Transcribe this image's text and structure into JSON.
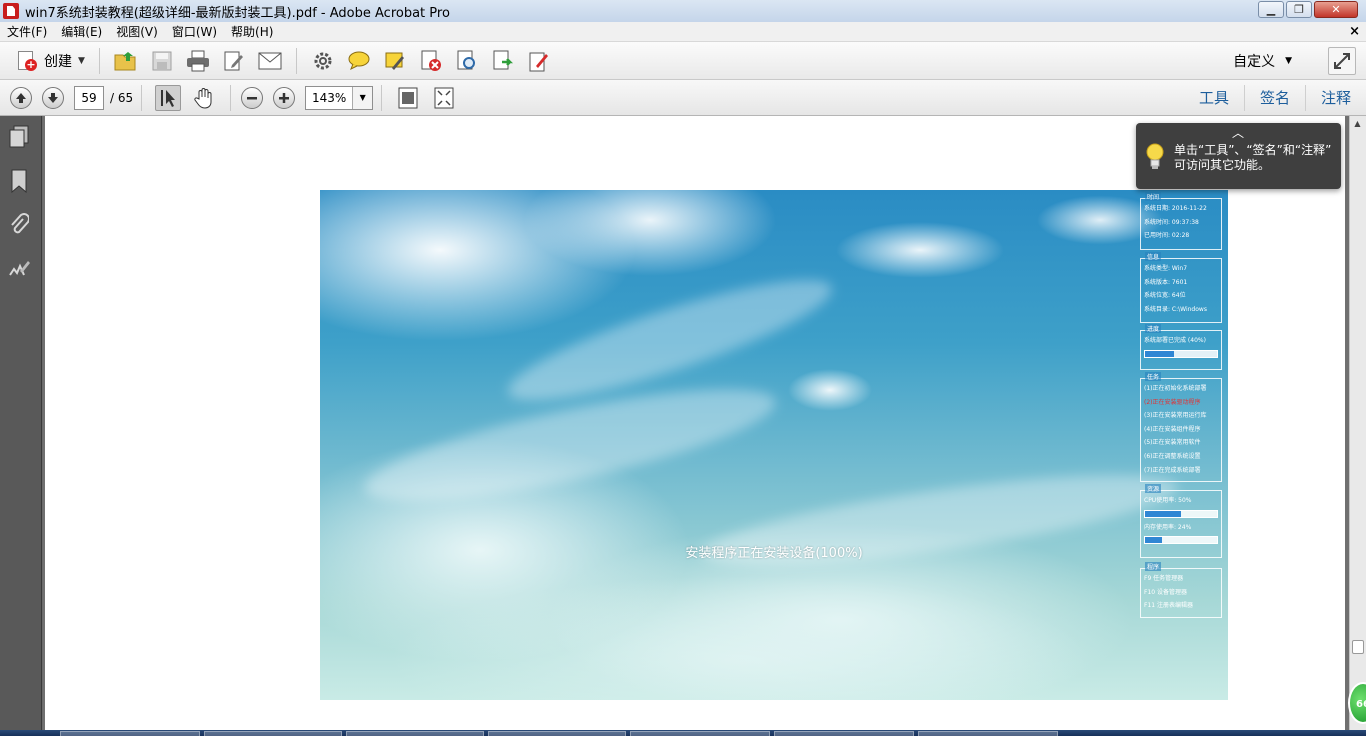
{
  "window": {
    "title": "win7系统封装教程(超级详细-最新版封装工具).pdf - Adobe Acrobat Pro",
    "minimize": "▁",
    "restore": "❐",
    "close": "✕"
  },
  "menu": {
    "items": [
      "文件(F)",
      "编辑(E)",
      "视图(V)",
      "窗口(W)",
      "帮助(H)"
    ],
    "close_label": "×"
  },
  "toolbar": {
    "create_label": "创建",
    "customize_label": "自定义"
  },
  "navigation": {
    "current_page": "59",
    "total_pages": "/ 65",
    "zoom": "143%"
  },
  "panels": {
    "tools": "工具",
    "sign": "签名",
    "comment": "注释"
  },
  "tooltip": {
    "message_line1": "单击“工具”、“签名”和“注释”",
    "message_line2": "可访问其它功能。"
  },
  "document": {
    "progress_text": "安装程序正在安装设备(100%)",
    "panel": {
      "time": {
        "title": "时间",
        "lines": [
          "系统日期:  2016-11-22",
          "系统时间:  09:37:38",
          "已用时间:  02:28"
        ]
      },
      "system": {
        "title": "信息",
        "lines": [
          "系统类型:  Win7",
          "系统版本:  7601",
          "系统位宽:  64位",
          "系统目录:  C:\\Windows"
        ]
      },
      "progress": {
        "title": "进度",
        "line": "系统部署已完成 (40%)",
        "value": 0.4
      },
      "tasks": {
        "title": "任务",
        "items": [
          {
            "text": "(1)正在初始化系统部署",
            "highlight": false
          },
          {
            "text": "(2)正在安装驱动程序",
            "highlight": true
          },
          {
            "text": "(3)正在安装常用运行库",
            "highlight": false
          },
          {
            "text": "(4)正在安装组件程序",
            "highlight": false
          },
          {
            "text": "(5)正在安装常用软件",
            "highlight": false
          },
          {
            "text": "(6)正在调整系统设置",
            "highlight": false
          },
          {
            "text": "(7)正在完成系统部署",
            "highlight": false
          }
        ]
      },
      "resources": {
        "title": "资源",
        "cpu_line": "CPU使用率:  50%",
        "cpu_value": 0.5,
        "mem_line": "内存使用率:  24%",
        "mem_value": 0.24
      },
      "shortcuts": {
        "title": "程序",
        "lines": [
          "F9  任务管理器",
          "F10  设备管理器",
          "F11  注册表编辑器"
        ]
      }
    }
  },
  "badge": "66"
}
